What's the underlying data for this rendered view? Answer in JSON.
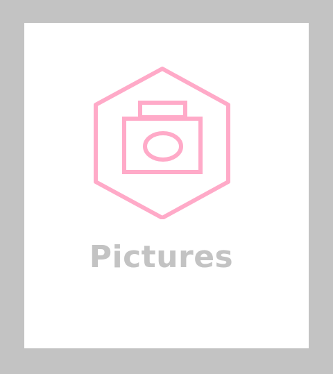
{
  "tile": {
    "label": "Pictures",
    "icon": "camera-hexagon-icon"
  },
  "colors": {
    "background": "#c3c3c3",
    "tile_background": "#ffffff",
    "icon_stroke": "#ffaac8",
    "label_text": "#c3c3c3"
  }
}
